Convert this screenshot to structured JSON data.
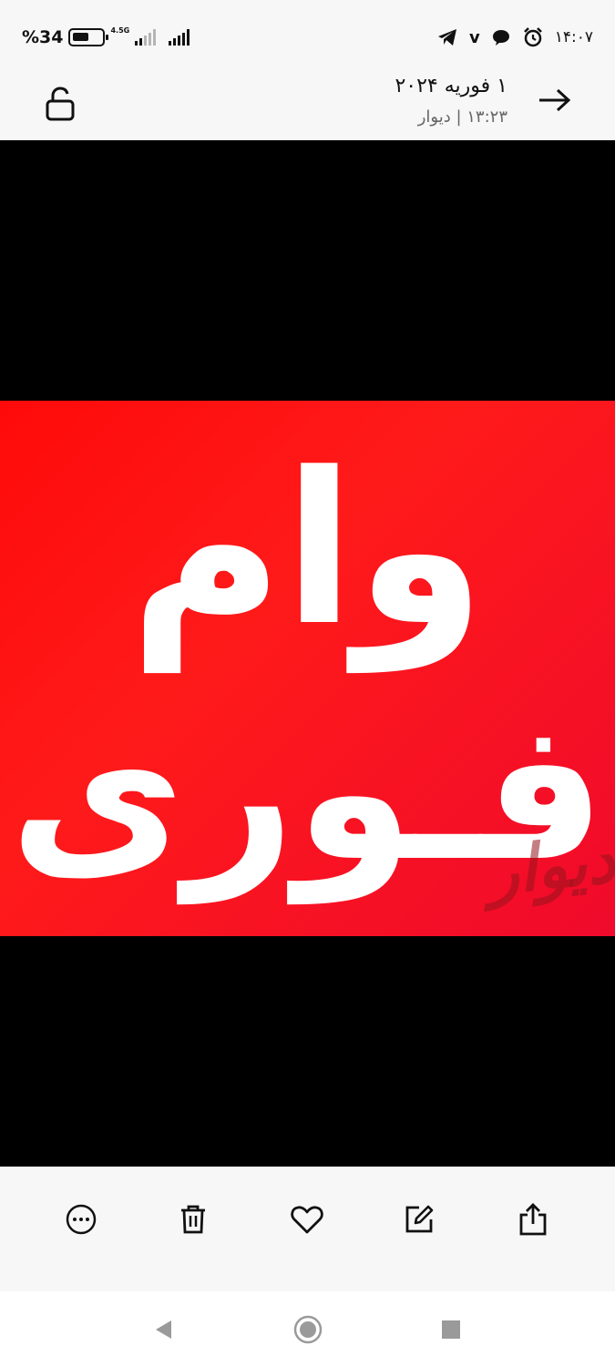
{
  "status_bar": {
    "battery_percent": "%34",
    "network_label": "4.5G",
    "clock": "۱۴:۰۷",
    "notification_badge": "v",
    "icons": [
      "telegram-icon",
      "chat-bubble-icon",
      "alarm-icon",
      "battery-icon",
      "signal-bars-icon"
    ]
  },
  "header": {
    "title": "۱ فوریه ۲۰۲۴",
    "subtitle": "۱۳:۲۳ | دیوار",
    "icons": [
      "lock-open-icon",
      "arrow-right-icon"
    ]
  },
  "image": {
    "line1": "وام",
    "line2": "فـوری",
    "watermark": "دیوار",
    "colors": {
      "background": "#000000",
      "poster": "#ff1414",
      "text": "#ffffff"
    }
  },
  "toolbar": {
    "icons": [
      "more-options-icon",
      "trash-icon",
      "heart-icon",
      "edit-icon",
      "share-icon"
    ]
  },
  "navbar": {
    "icons": [
      "back-triangle-icon",
      "home-circle-icon",
      "recents-square-icon"
    ]
  }
}
